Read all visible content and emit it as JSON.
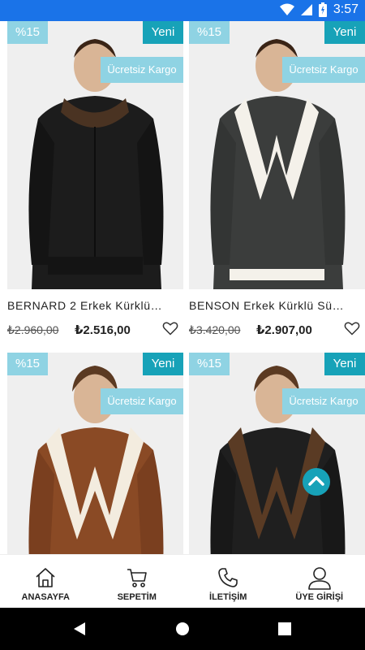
{
  "status_bar": {
    "time": "3:57",
    "icons": [
      "wifi-icon",
      "signal-icon",
      "battery-icon"
    ]
  },
  "products": [
    {
      "discount": "%15",
      "new_badge": "Yeni",
      "shipping_badge": "Ücretsiz Kargo",
      "name": "BERNARD 2 Erkek Kürklü…",
      "old_price": "₺2.960,00",
      "price": "₺2.516,00",
      "jacket_color": "#1c1c1c",
      "collar_color": "#4a3322"
    },
    {
      "discount": "%15",
      "new_badge": "Yeni",
      "shipping_badge": "Ücretsiz Kargo",
      "name": "BENSON Erkek Kürklü Sü…",
      "old_price": "₺3.420,00",
      "price": "₺2.907,00",
      "jacket_color": "#3b3d3c",
      "collar_color": "#f4f1ea"
    },
    {
      "discount": "%15",
      "new_badge": "Yeni",
      "shipping_badge": "Ücretsiz Kargo",
      "jacket_color": "#8a4a25",
      "collar_color": "#f3ecdf"
    },
    {
      "discount": "%15",
      "new_badge": "Yeni",
      "shipping_badge": "Ücretsiz Kargo",
      "jacket_color": "#1f1f1f",
      "collar_color": "#5a3b24"
    }
  ],
  "tabbar": [
    {
      "label": "ANASAYFA",
      "icon": "home-icon"
    },
    {
      "label": "SEPETİM",
      "icon": "cart-icon"
    },
    {
      "label": "İLETİŞİM",
      "icon": "phone-icon"
    },
    {
      "label": "ÜYE GİRİŞİ",
      "icon": "user-icon"
    }
  ],
  "colors": {
    "accent": "#17a2b8",
    "badge_light": "#8fd3e3",
    "status_bar": "#1a73e8"
  }
}
